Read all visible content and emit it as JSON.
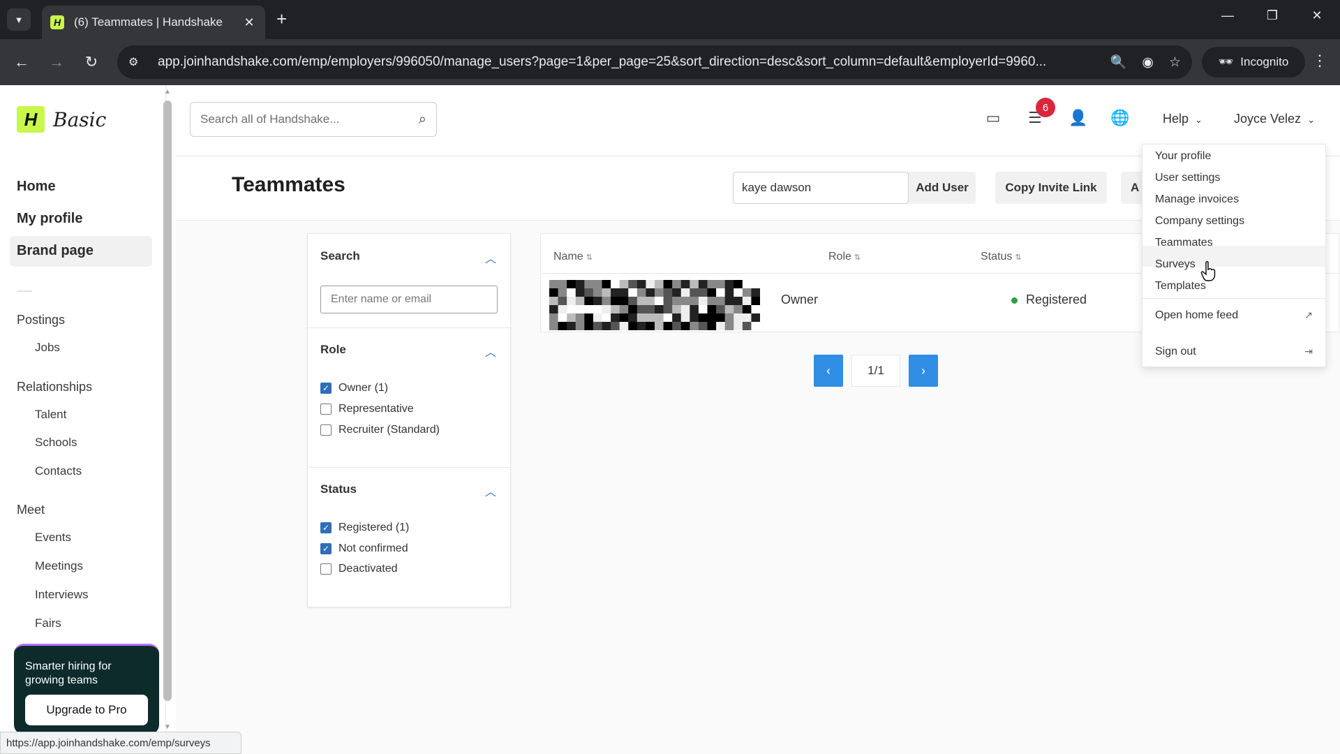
{
  "browser": {
    "tab_title": "(6) Teammates | Handshake",
    "url": "app.joinhandshake.com/emp/employers/996050/manage_users?page=1&per_page=25&sort_direction=desc&sort_column=default&employerId=9960...",
    "incognito_label": "Incognito",
    "status_url": "https://app.joinhandshake.com/emp/surveys"
  },
  "sidebar": {
    "logo_text": "Basic",
    "main_items": [
      {
        "label": "Home"
      },
      {
        "label": "My profile"
      },
      {
        "label": "Brand page"
      }
    ],
    "sections": [
      {
        "label": "Postings",
        "items": [
          "Jobs"
        ]
      },
      {
        "label": "Relationships",
        "items": [
          "Talent",
          "Schools",
          "Contacts"
        ]
      },
      {
        "label": "Meet",
        "items": [
          "Events",
          "Meetings",
          "Interviews",
          "Fairs"
        ]
      }
    ],
    "promo_text": "Smarter hiring for growing teams",
    "promo_button": "Upgrade to Pro"
  },
  "header": {
    "search_placeholder": "Search all of Handshake...",
    "notification_count": "6",
    "help_label": "Help",
    "user_name": "Joyce Velez"
  },
  "subheader": {
    "title": "Teammates",
    "user_input_value": "kaye dawson",
    "add_user_label": "Add User",
    "copy_invite_label": "Copy Invite Link",
    "more_label": "A"
  },
  "filters": {
    "search_heading": "Search",
    "search_placeholder": "Enter name or email",
    "role_heading": "Role",
    "roles": [
      {
        "label": "Owner (1)",
        "checked": true
      },
      {
        "label": "Representative",
        "checked": false
      },
      {
        "label": "Recruiter (Standard)",
        "checked": false
      }
    ],
    "status_heading": "Status",
    "statuses": [
      {
        "label": "Registered (1)",
        "checked": true
      },
      {
        "label": "Not confirmed",
        "checked": true
      },
      {
        "label": "Deactivated",
        "checked": false
      }
    ]
  },
  "table": {
    "columns": [
      "Name",
      "Role",
      "Status"
    ],
    "rows": [
      {
        "role": "Owner",
        "status": "Registered"
      }
    ]
  },
  "pagination": {
    "label": "1/1"
  },
  "dropdown": {
    "items": [
      "Your profile",
      "User settings",
      "Manage invoices",
      "Company settings",
      "Teammates",
      "Surveys",
      "Templates"
    ],
    "open_home_feed": "Open home feed",
    "sign_out": "Sign out"
  },
  "colors": {
    "brand": "#c8f74a",
    "link_blue": "#2f6fb8",
    "pager_blue": "#2f8de4",
    "status_green": "#2ea043",
    "badge_red": "#d7263d"
  }
}
